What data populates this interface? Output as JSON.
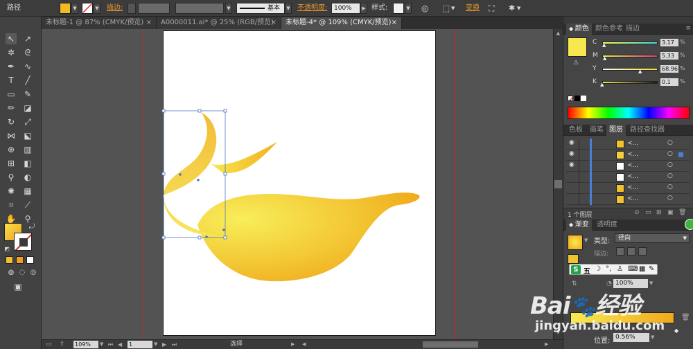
{
  "control_bar": {
    "selection_type": "路径",
    "stroke_label": "描边",
    "stroke_colon": ":",
    "brush_style": "基本",
    "opacity_label": "不透明度",
    "opacity_colon": ":",
    "opacity_value": "100%",
    "style_label": "样式",
    "style_colon": ":",
    "transform_label": "变换",
    "fill_color": "#f5b926"
  },
  "tabs": [
    {
      "label": "未标题-1 @ 87% (CMYK/预览)",
      "close": "×"
    },
    {
      "label": "A0000011.ai* @ 25% (RGB/预览)",
      "close": "×"
    },
    {
      "label": "未标题-4* @ 109% (CMYK/预览)",
      "close": "×"
    }
  ],
  "status": {
    "zoom": "109%",
    "page": "1",
    "tool": "选择"
  },
  "color_panel": {
    "tabs": [
      "颜色",
      "颜色参考",
      "描边"
    ],
    "channels": [
      {
        "name": "C",
        "value": "3.17"
      },
      {
        "name": "M",
        "value": "5.33"
      },
      {
        "name": "Y",
        "value": "68.96"
      },
      {
        "name": "K",
        "value": "0.1"
      }
    ],
    "swatch_color": "#f7e84f"
  },
  "layers_panel": {
    "tabs": [
      "色板",
      "画笔",
      "图层",
      "路径查找器"
    ],
    "row_label": "<...",
    "footer_count": "1 个图层"
  },
  "gradient_panel": {
    "tabs": [
      "渐变",
      "透明度"
    ],
    "type_label": "类型",
    "type_colon": ":",
    "type_value": "径向",
    "stroke_label": "描边",
    "stroke_colon": ":",
    "opacity_value": "100%",
    "position_label": "位置",
    "position_colon": ":",
    "position_value": "0.56%"
  },
  "ime_toolbar": {
    "logo": "S",
    "mode": "五"
  },
  "watermark": {
    "brand": "Bai",
    "brand_end": "经验",
    "url": "jingyan.baidu.com"
  }
}
